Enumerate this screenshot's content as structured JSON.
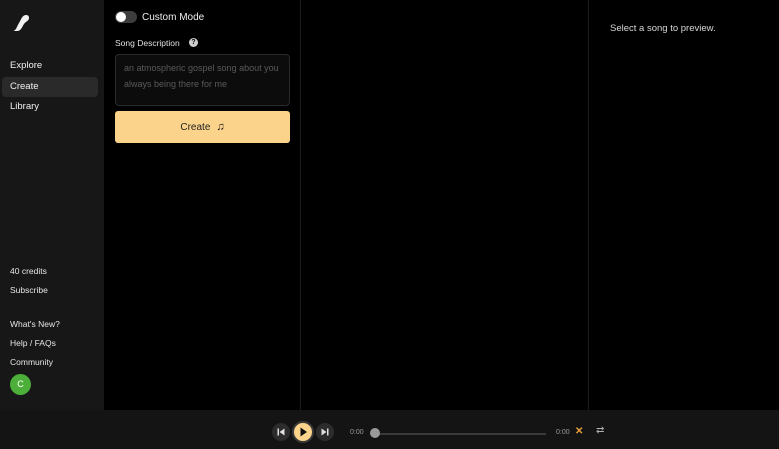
{
  "sidebar": {
    "nav": [
      {
        "label": "Explore",
        "active": false
      },
      {
        "label": "Create",
        "active": true
      },
      {
        "label": "Library",
        "active": false
      }
    ],
    "credits": "40 credits",
    "subscribe": "Subscribe",
    "links": [
      "What's New?",
      "Help / FAQs",
      "Community"
    ],
    "avatar_initial": "C"
  },
  "create": {
    "custom_mode_label": "Custom Mode",
    "custom_mode_on": false,
    "description_label": "Song Description",
    "description_placeholder": "an atmospheric gospel song about you always being there for me",
    "create_button_label": "Create"
  },
  "preview": {
    "empty_text": "Select a song to preview."
  },
  "player": {
    "time_current": "0:00",
    "time_total": "0:00",
    "progress": 0
  },
  "colors": {
    "accent": "#fbd38a",
    "avatar": "#4caf3a",
    "shuffle": "#e8a23a"
  },
  "icons": {
    "logo": "app-logo-icon",
    "help": "question-circle-icon",
    "create": "music-note-icon",
    "prev": "skip-previous-icon",
    "play": "play-icon",
    "next": "skip-next-icon",
    "shuffle": "shuffle-icon",
    "repeat": "repeat-icon"
  }
}
